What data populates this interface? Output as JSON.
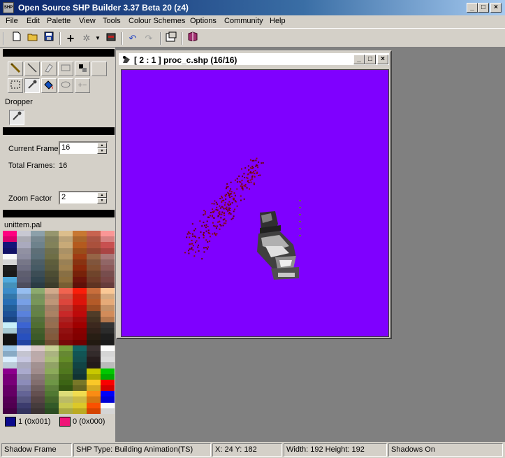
{
  "window": {
    "title": "Open Source SHP Builder 3.37 Beta 20 (z4)",
    "app_icon_text": "SHP"
  },
  "menu": [
    "File",
    "Edit",
    "Palette",
    "View",
    "Tools",
    "Colour Schemes",
    "Options",
    "Community",
    "Help"
  ],
  "left": {
    "tool_name": "Dropper",
    "current_frame_label": "Current Frame",
    "current_frame_value": "16",
    "total_frames_label": "Total Frames:",
    "total_frames_value": "16",
    "zoom_label": "Zoom Factor",
    "zoom_value": "2",
    "palette_name": "unittem.pal",
    "left_colour_label": "1 (0x001)",
    "right_colour_label": "0 (0x000)",
    "left_colour": "#0a0a8c",
    "right_colour": "#f01478"
  },
  "child": {
    "title": "[ 2 : 1 ] proc_c.shp (16/16)",
    "canvas_color": "#7f00ff"
  },
  "status": {
    "mode": "Shadow Frame",
    "type": "SHP Type: Building Animation(TS)",
    "coords": "X: 24 Y: 182",
    "size": "Width: 192 Height: 192",
    "shadows": "Shadows On"
  }
}
